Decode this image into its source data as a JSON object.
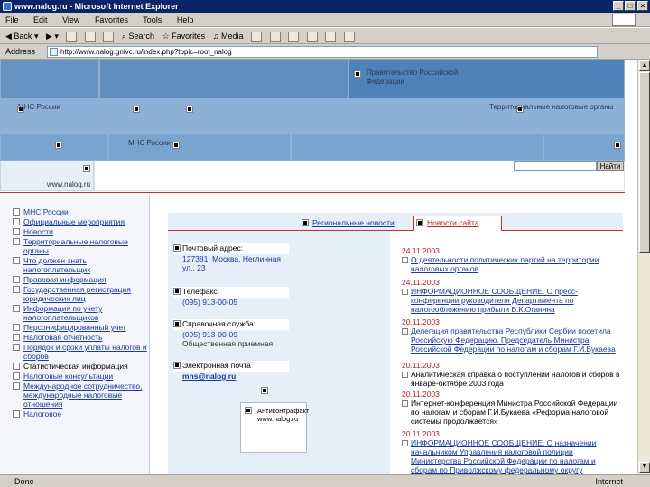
{
  "window": {
    "title": "www.nalog.ru - Microsoft Internet Explorer",
    "minimize": "_",
    "maximize": "□",
    "close": "×"
  },
  "menu": [
    "File",
    "Edit",
    "View",
    "Favorites",
    "Tools",
    "Help"
  ],
  "toolbar": {
    "back": "Back",
    "search": "Search",
    "favorites": "Favorites",
    "media": "Media"
  },
  "address": {
    "label": "Address",
    "url": "http://www.nalog.gnivc.ru/index.php?topic=root_nalog"
  },
  "banner": {
    "gov_link": "Правительство Российской Федерации",
    "mns_link_1": "МНС России",
    "territorial_link": "Территориальные налоговые органы",
    "mns_link_2": "МНС России",
    "url_label": "www.nalog.ru",
    "search_button": "Найти"
  },
  "nav": [
    {
      "label": "МНС России",
      "link": true
    },
    {
      "label": "Официальные мероприятия",
      "link": true
    },
    {
      "label": "Новости",
      "link": true
    },
    {
      "label": "Территориальные налоговые органы",
      "link": true
    },
    {
      "label": "Что должен знать налогоплательщик",
      "link": true
    },
    {
      "label": "Правовая информация",
      "link": true
    },
    {
      "label": "Государственная регистрация юридических лиц",
      "link": true
    },
    {
      "label": "Информация по учету налогоплательщиков",
      "link": true
    },
    {
      "label": "Персонифицированный учет",
      "link": true
    },
    {
      "label": "Налоговая отчетность",
      "link": true
    },
    {
      "label": "Порядок и сроки уплаты налогов и сборов",
      "link": true
    },
    {
      "label": "Статистическая информация",
      "link": false
    },
    {
      "label": "Налоговые консультации",
      "link": true
    },
    {
      "label": "Международное сотрудничество, международные налоговые отношения",
      "link": true
    },
    {
      "label": "Налоговое",
      "link": true
    }
  ],
  "tabs": {
    "regional": "Региональные новости",
    "site": "Новости сайта"
  },
  "contact": {
    "postal_label": "Почтовый адрес:",
    "postal_value": "127381, Москва, Неглинная ул., 23",
    "phones_label": "Телефакс:",
    "phones_value": "(095) 913-00-05",
    "help_label": "Справочная служба:",
    "help_value": "(095) 913-00-09",
    "help_note": "Общественная приемная",
    "email_label": "Электронная почта",
    "email_value": "mns@nalog.ru"
  },
  "anticontrafact": "Антиконтрафакт www.nalog.ru",
  "news": [
    {
      "date": "24.11.2003",
      "text": "О деятельности политических партий на территории налоговых органов",
      "link": true
    },
    {
      "date": "24.11.2003",
      "text": "ИНФОРМАЦИОННОЕ СООБЩЕНИЕ. О пресс-конференции руководителя Департамента по налогообложению прибыли В.К.Оганяна",
      "link": true
    },
    {
      "date": "20.11.2003",
      "text": "Делегация правительства Республики Сербии посетила Российскую Федерацию. Председатель Министра Российской Федерации по налогам и сборам Г.И.Букаева",
      "link": true
    },
    {
      "date": "20.11.2003",
      "text": "Аналитическая справка о поступлении налогов и сборов в январе-октябре 2003 года",
      "link": false
    },
    {
      "date": "20.11.2003",
      "text": "Интернет-конференция Министра Российской Федерации по налогам и сборам Г.И.Букаева «Реформа налоговой системы продолжается»",
      "link": false
    },
    {
      "date": "20.11.2003",
      "text": "ИНФОРМАЦИОННОЕ СООБЩЕНИЕ. О назначении начальником Управления налоговой полиции Министерства Российской Федерации по налогам и сборам по Приволжскому федеральному округу",
      "link": true
    }
  ],
  "status": {
    "text": "Done",
    "zone": "Internet"
  }
}
